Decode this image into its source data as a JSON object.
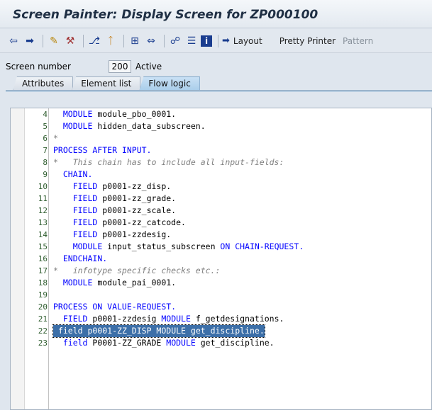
{
  "window": {
    "title": "Screen Painter: Display Screen for ZP000100"
  },
  "toolbar": {
    "icons": [
      "back-arrow-icon",
      "forward-arrow-icon",
      "display-change-icon",
      "activate-icon",
      "other-object-icon",
      "check-icon",
      "where-used-icon",
      "screen-icon",
      "navigate-icon",
      "hierarchy-icon",
      "field-list-icon",
      "info-icon"
    ],
    "layout_label": "Layout",
    "pretty_printer_label": "Pretty Printer",
    "pattern_label": "Pattern"
  },
  "screen": {
    "label": "Screen number",
    "number": "200",
    "status": "Active"
  },
  "tabs": [
    {
      "label": "Attributes",
      "active": false
    },
    {
      "label": "Element list",
      "active": false
    },
    {
      "label": "Flow logic",
      "active": true
    }
  ],
  "code_lines": [
    {
      "num": "4",
      "segs": [
        [
          "pl",
          "  "
        ],
        [
          "kw",
          "MODULE"
        ],
        [
          "pl",
          " module_pbo_0001."
        ]
      ]
    },
    {
      "num": "5",
      "segs": [
        [
          "pl",
          "  "
        ],
        [
          "kw",
          "MODULE"
        ],
        [
          "pl",
          " hidden_data_subscreen."
        ]
      ]
    },
    {
      "num": "6",
      "segs": [
        [
          "cm",
          "*"
        ]
      ]
    },
    {
      "num": "7",
      "segs": [
        [
          "kw",
          "PROCESS AFTER INPUT."
        ]
      ]
    },
    {
      "num": "8",
      "segs": [
        [
          "cm",
          "*   This chain has to include all input-fields:"
        ]
      ]
    },
    {
      "num": "9",
      "segs": [
        [
          "pl",
          "  "
        ],
        [
          "kw",
          "CHAIN."
        ]
      ]
    },
    {
      "num": "10",
      "segs": [
        [
          "pl",
          "    "
        ],
        [
          "kw",
          "FIELD"
        ],
        [
          "pl",
          " p0001-zz_disp."
        ]
      ]
    },
    {
      "num": "11",
      "segs": [
        [
          "pl",
          "    "
        ],
        [
          "kw",
          "FIELD"
        ],
        [
          "pl",
          " p0001-zz_grade."
        ]
      ]
    },
    {
      "num": "12",
      "segs": [
        [
          "pl",
          "    "
        ],
        [
          "kw",
          "FIELD"
        ],
        [
          "pl",
          " p0001-zz_scale."
        ]
      ]
    },
    {
      "num": "13",
      "segs": [
        [
          "pl",
          "    "
        ],
        [
          "kw",
          "FIELD"
        ],
        [
          "pl",
          " p0001-zz_catcode."
        ]
      ]
    },
    {
      "num": "14",
      "segs": [
        [
          "pl",
          "    "
        ],
        [
          "kw",
          "FIELD"
        ],
        [
          "pl",
          " p0001-zzdesig."
        ]
      ]
    },
    {
      "num": "15",
      "segs": [
        [
          "pl",
          "    "
        ],
        [
          "kw",
          "MODULE"
        ],
        [
          "pl",
          " input_status_subscreen "
        ],
        [
          "kw",
          "ON CHAIN-REQUEST."
        ]
      ]
    },
    {
      "num": "16",
      "segs": [
        [
          "pl",
          "  "
        ],
        [
          "kw",
          "ENDCHAIN."
        ]
      ]
    },
    {
      "num": "17",
      "segs": [
        [
          "cm",
          "*   infotype specific checks etc.:"
        ]
      ]
    },
    {
      "num": "18",
      "segs": [
        [
          "pl",
          "  "
        ],
        [
          "kw",
          "MODULE"
        ],
        [
          "pl",
          " module_pai_0001."
        ]
      ]
    },
    {
      "num": "19",
      "segs": []
    },
    {
      "num": "20",
      "segs": [
        [
          "kw",
          "PROCESS ON VALUE-REQUEST."
        ]
      ]
    },
    {
      "num": "21",
      "segs": [
        [
          "pl",
          "  "
        ],
        [
          "kw",
          "FIELD"
        ],
        [
          "pl",
          " p0001-zzdesig "
        ],
        [
          "kw",
          "MODULE"
        ],
        [
          "pl",
          " f_getdesignations."
        ]
      ]
    },
    {
      "num": "22",
      "selected": true,
      "segs": [
        [
          "pl",
          " "
        ],
        [
          "kw",
          "field"
        ],
        [
          "pl",
          " p0001-ZZ_DISP "
        ],
        [
          "kw",
          "MODULE"
        ],
        [
          "pl",
          " get_discipline."
        ]
      ]
    },
    {
      "num": "23",
      "segs": [
        [
          "pl",
          "  "
        ],
        [
          "kw",
          "field"
        ],
        [
          "pl",
          " P0001-ZZ_GRADE "
        ],
        [
          "kw",
          "MODULE"
        ],
        [
          "pl",
          " get_discipline."
        ]
      ]
    }
  ]
}
